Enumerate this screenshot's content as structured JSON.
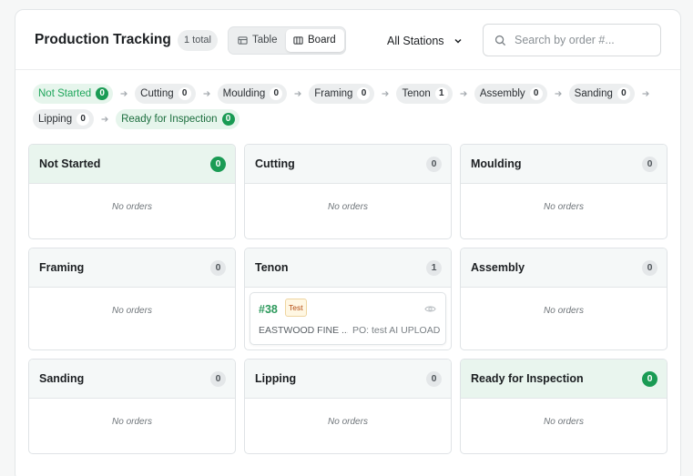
{
  "header": {
    "title": "Production Tracking",
    "total_badge": "1 total",
    "view_toggle": {
      "table_label": "Table",
      "board_label": "Board",
      "active": "Board"
    },
    "station_filter": {
      "selected": "All Stations"
    },
    "search": {
      "placeholder": "Search by order #...",
      "value": ""
    }
  },
  "pipeline": [
    {
      "label": "Not Started",
      "count": "0",
      "style": "start"
    },
    {
      "label": "Cutting",
      "count": "0",
      "style": ""
    },
    {
      "label": "Moulding",
      "count": "0",
      "style": ""
    },
    {
      "label": "Framing",
      "count": "0",
      "style": ""
    },
    {
      "label": "Tenon",
      "count": "1",
      "style": ""
    },
    {
      "label": "Assembly",
      "count": "0",
      "style": ""
    },
    {
      "label": "Sanding",
      "count": "0",
      "style": ""
    },
    {
      "label": "Lipping",
      "count": "0",
      "style": ""
    },
    {
      "label": "Ready for Inspection",
      "count": "0",
      "style": "ready"
    }
  ],
  "board": {
    "empty_text": "No orders",
    "columns": [
      {
        "title": "Not Started",
        "count": "0"
      },
      {
        "title": "Cutting",
        "count": "0"
      },
      {
        "title": "Moulding",
        "count": "0"
      },
      {
        "title": "Framing",
        "count": "0"
      },
      {
        "title": "Tenon",
        "count": "1"
      },
      {
        "title": "Assembly",
        "count": "0"
      },
      {
        "title": "Sanding",
        "count": "0"
      },
      {
        "title": "Lipping",
        "count": "0"
      },
      {
        "title": "Ready for Inspection",
        "count": "0"
      }
    ],
    "order": {
      "number": "#38",
      "tag": "Test",
      "customer": "EASTWOOD FINE ...",
      "po": "PO: test AI UPLOAD"
    }
  },
  "colors": {
    "accent_green": "#1a9b54",
    "order_number": "#2e9a5d",
    "tag_text": "#b44b11",
    "tag_bg": "#fff7e3"
  },
  "icons": {
    "table_icon": "table-icon",
    "board_icon": "columns-icon",
    "dropdown_icon": "chevron-down-icon",
    "search_icon": "search-icon",
    "pipeline_separator": "arrow-right-icon",
    "order_view": "eye-icon"
  }
}
